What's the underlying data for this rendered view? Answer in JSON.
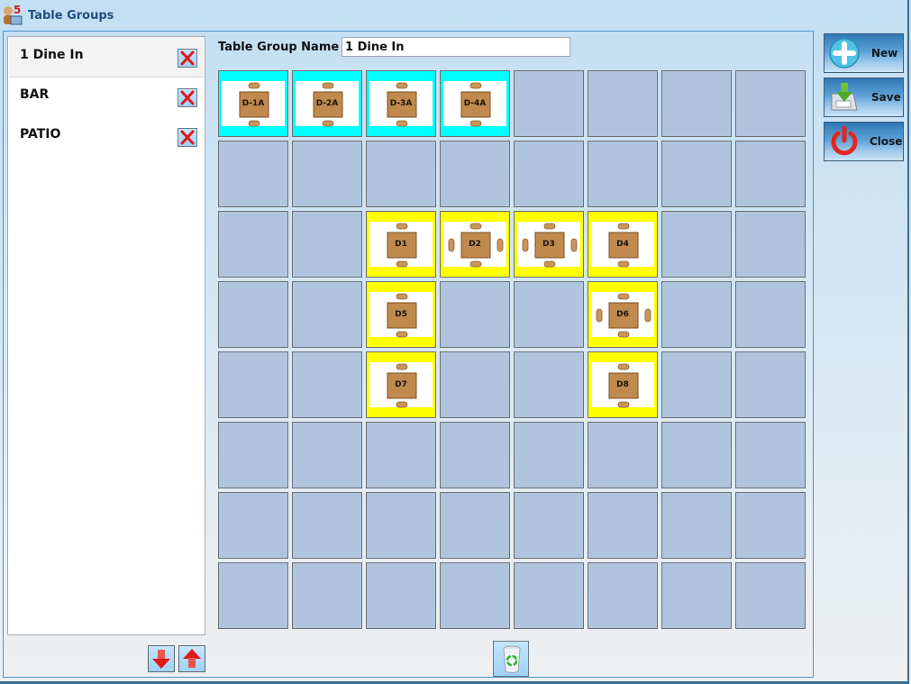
{
  "window": {
    "title": "Table Groups",
    "app_icon": "pos-app-icon",
    "app_icon_badge": "5"
  },
  "groups": {
    "items": [
      {
        "label": "1 Dine In",
        "selected": true,
        "delete_icon": "delete-x-icon"
      },
      {
        "label": "BAR",
        "selected": false,
        "delete_icon": "delete-x-icon"
      },
      {
        "label": "PATIO",
        "selected": false,
        "delete_icon": "delete-x-icon"
      }
    ],
    "move_down_icon": "arrow-down-icon",
    "move_up_icon": "arrow-up-icon"
  },
  "editor": {
    "name_label": "Table Group Name",
    "name_value": "1 Dine In"
  },
  "grid": {
    "columns": 8,
    "rows": 8,
    "colors": {
      "empty": "#b0c4de",
      "cyan_group": "#00ffff",
      "yellow_group": "#ffff00"
    },
    "tables": [
      {
        "label": "D-1A",
        "row": 0,
        "col": 0,
        "color": "#00ffff",
        "side_chairs": false
      },
      {
        "label": "D-2A",
        "row": 0,
        "col": 1,
        "color": "#00ffff",
        "side_chairs": false
      },
      {
        "label": "D-3A",
        "row": 0,
        "col": 2,
        "color": "#00ffff",
        "side_chairs": false
      },
      {
        "label": "D-4A",
        "row": 0,
        "col": 3,
        "color": "#00ffff",
        "side_chairs": false
      },
      {
        "label": "D1",
        "row": 2,
        "col": 2,
        "color": "#ffff00",
        "side_chairs": false
      },
      {
        "label": "D2",
        "row": 2,
        "col": 3,
        "color": "#ffff00",
        "side_chairs": true
      },
      {
        "label": "D3",
        "row": 2,
        "col": 4,
        "color": "#ffff00",
        "side_chairs": true
      },
      {
        "label": "D4",
        "row": 2,
        "col": 5,
        "color": "#ffff00",
        "side_chairs": false
      },
      {
        "label": "D5",
        "row": 3,
        "col": 2,
        "color": "#ffff00",
        "side_chairs": false
      },
      {
        "label": "D6",
        "row": 3,
        "col": 5,
        "color": "#ffff00",
        "side_chairs": true
      },
      {
        "label": "D7",
        "row": 4,
        "col": 2,
        "color": "#ffff00",
        "side_chairs": false
      },
      {
        "label": "D8",
        "row": 4,
        "col": 5,
        "color": "#ffff00",
        "side_chairs": false
      }
    ]
  },
  "bottom": {
    "recycle_icon": "recycle-bin-icon"
  },
  "actions": [
    {
      "label": "New",
      "icon": "plus-icon"
    },
    {
      "label": "Save",
      "icon": "save-icon"
    },
    {
      "label": "Close",
      "icon": "power-icon"
    }
  ]
}
